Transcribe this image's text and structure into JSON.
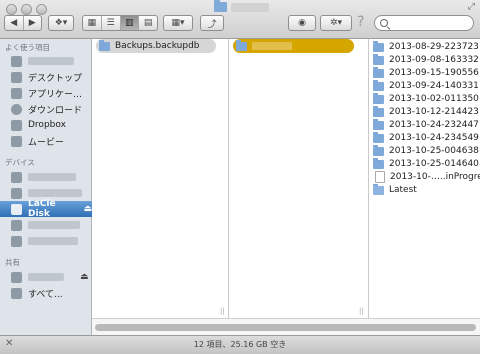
{
  "window": {
    "resize_icon": "fullscreen-arrows-icon"
  },
  "toolbar": {
    "back_icon": "◀",
    "forward_icon": "▶",
    "dropbox_icon": "❖▾",
    "view_icons": [
      "▦",
      "☰",
      "▥",
      "▤"
    ],
    "arrange_icon": "▦▾",
    "share_icon": "⤴",
    "quicklook_icon": "◉",
    "action_icon": "✲▾",
    "help_icon": "?"
  },
  "sidebar": {
    "favorites_header": "よく使う項目",
    "favorites": [
      {
        "label": "",
        "icon": "home-icon"
      },
      {
        "label": "デスクトップ",
        "icon": "desktop-icon"
      },
      {
        "label": "アプリケー…",
        "icon": "applications-icon"
      },
      {
        "label": "ダウンロード",
        "icon": "downloads-icon"
      },
      {
        "label": "Dropbox",
        "icon": "dropbox-icon"
      },
      {
        "label": "ムービー",
        "icon": "movies-icon"
      }
    ],
    "devices_header": "デバイス",
    "devices": [
      {
        "label": "",
        "icon": "disk-icon"
      },
      {
        "label": "",
        "icon": "disk-icon"
      },
      {
        "label": "LaCie Disk",
        "icon": "external-disk-icon",
        "selected": true,
        "eject": "⏏"
      },
      {
        "label": "",
        "icon": "disk-icon"
      },
      {
        "label": "",
        "icon": "disk-icon"
      }
    ],
    "shared_header": "共有",
    "shared": [
      {
        "label": "",
        "icon": "network-display-icon",
        "eject": "⏏"
      },
      {
        "label": "すべて...",
        "icon": "network-icon"
      }
    ]
  },
  "columns": {
    "first": [
      "Backups.backupdb"
    ],
    "second": [
      ""
    ],
    "third": [
      "2013-08-29-223723",
      "2013-09-08-163332",
      "2013-09-15-190556",
      "2013-09-24-140331",
      "2013-10-02-011350",
      "2013-10-12-214423",
      "2013-10-24-232447",
      "2013-10-24-234549",
      "2013-10-25-004638",
      "2013-10-25-014640",
      "2013-10-…..inProgress",
      "Latest"
    ]
  },
  "status": {
    "text": "12 項目、25.16 GB 空き"
  },
  "colors": {
    "selection_blue": "#2f6fb7",
    "selection_gold": "#d6a600",
    "folder_blue": "#7fa9d9"
  }
}
